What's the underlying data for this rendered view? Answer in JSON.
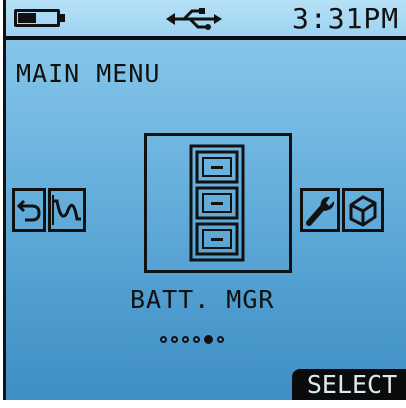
{
  "status_bar": {
    "battery_level": 0.4,
    "usb_icon": "usb-icon",
    "time": "3:31PM"
  },
  "menu": {
    "title": "MAIN MENU",
    "selected_label": "BATT. MGR",
    "page_count": 6,
    "active_page": 5,
    "items": [
      {
        "icon": "back-arrow-icon"
      },
      {
        "icon": "waveform-icon"
      },
      {
        "icon": "battery-cabinet-icon"
      },
      {
        "icon": "wrench-icon"
      },
      {
        "icon": "cube-icon"
      }
    ]
  },
  "softkey": {
    "select_label": "SELECT"
  },
  "colors": {
    "screen_top": "#8fcbec",
    "screen_bottom": "#3f8ec4",
    "ink": "#111111"
  }
}
